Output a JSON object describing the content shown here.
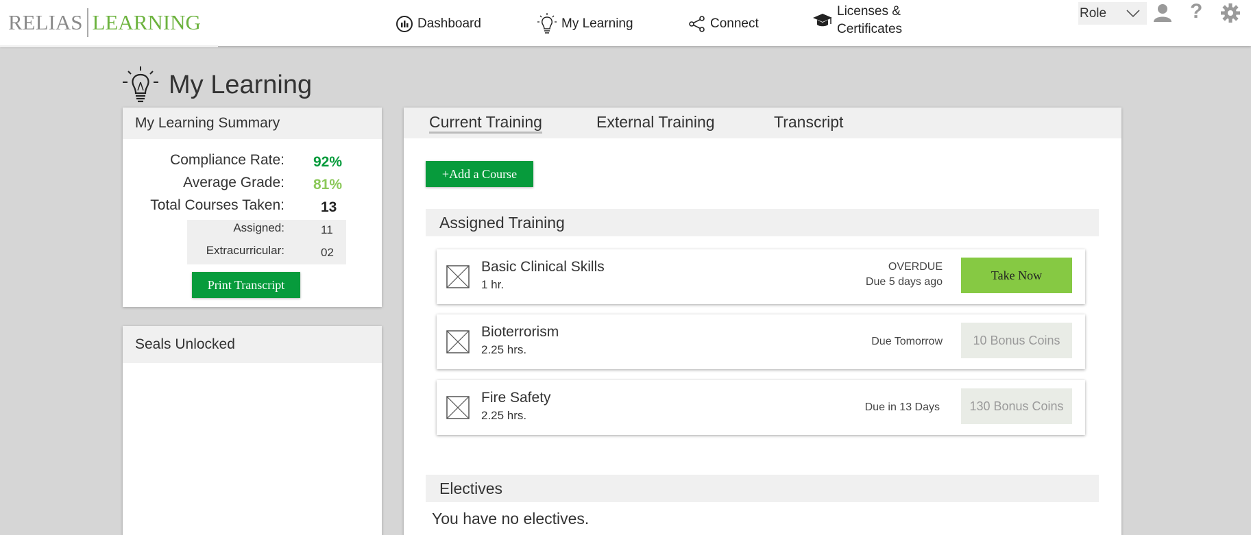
{
  "header": {
    "logo": {
      "part1": "RELIAS",
      "part2": "LEARNING"
    },
    "nav": {
      "dashboard": "Dashboard",
      "my_learning": "My Learning",
      "connect": "Connect",
      "licenses_line1": "Licenses &",
      "licenses_line2": "Certificates"
    },
    "role": "Role"
  },
  "page": {
    "title": "My Learning"
  },
  "summary": {
    "title": "My Learning Summary",
    "compliance_label": "Compliance Rate:",
    "compliance_value": "92%",
    "grade_label": "Average Grade:",
    "grade_value": "81%",
    "total_label": "Total Courses Taken:",
    "total_value": "13",
    "assigned_label": "Assigned:",
    "assigned_value": "11",
    "extra_label": "Extracurricular:",
    "extra_value": "02",
    "print_button": "Print Transcript"
  },
  "seals": {
    "title": "Seals Unlocked"
  },
  "tabs": {
    "current": "Current Training",
    "external": "External Training",
    "transcript": "Transcript"
  },
  "add_course_button": "+Add a Course",
  "assigned": {
    "title": "Assigned Training",
    "courses": [
      {
        "name": "Basic Clinical Skills",
        "duration": "1 hr.",
        "status1": "OVERDUE",
        "status2": "Due 5 days ago",
        "action": "Take Now"
      },
      {
        "name": "Bioterrorism",
        "duration": "2.25 hrs.",
        "status1": "Due Tomorrow",
        "action": "10 Bonus Coins"
      },
      {
        "name": "Fire Safety",
        "duration": "2.25 hrs.",
        "status1": "Due in 13 Days",
        "action": "130 Bonus Coins"
      }
    ]
  },
  "electives": {
    "title": "Electives",
    "empty": "You have no electives."
  },
  "colors": {
    "brand_green": "#6db33f",
    "button_green": "#079b3c",
    "take_now_green": "#86c943",
    "compliance_green": "#079b3c",
    "grade_green": "#8cc85a"
  }
}
